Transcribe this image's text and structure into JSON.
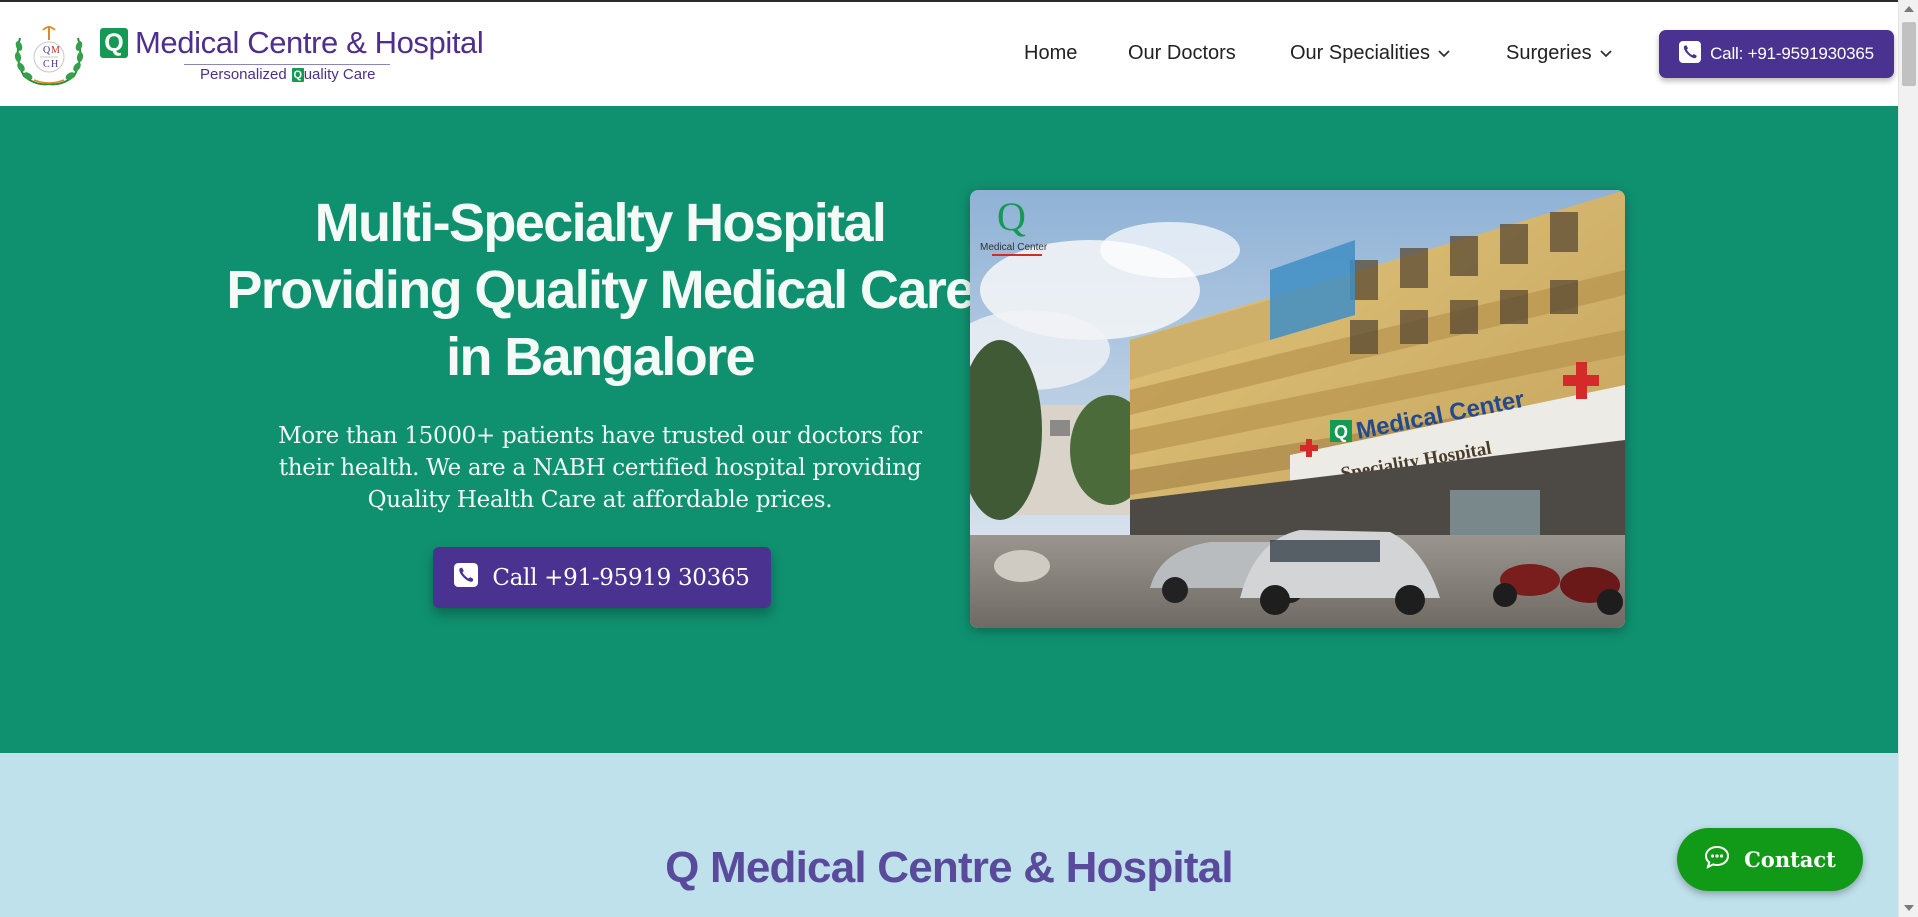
{
  "header": {
    "emblem_letters": [
      "Q",
      "M",
      "C",
      "H"
    ],
    "brand_q": "Q",
    "brand_name": "Medical Centre & Hospital",
    "tagline_pre": "Personalized",
    "tagline_q": "Q",
    "tagline_post": "uality Care",
    "nav": [
      {
        "label": "Home"
      },
      {
        "label": "Our Doctors"
      },
      {
        "label": "Our Specialities",
        "has_dropdown": true
      },
      {
        "label": "Surgeries",
        "has_dropdown": true
      }
    ],
    "call_button": "Call: +91-9591930365"
  },
  "hero": {
    "title": "Multi-Specialty Hospital Providing Quality Medical Care in Bangalore",
    "subtitle": "More than 15000+ patients have trusted our doctors for their health. We are a NABH certified hospital providing Quality Health Care at affordable prices.",
    "call_button": "Call +91-95919 30365",
    "photo": {
      "logo_q": "Q",
      "logo_text": "Medical Center",
      "sign_main": "Medical Center",
      "sign_sub": "Speciality Hospital"
    }
  },
  "about": {
    "title": "Q Medical Centre & Hospital"
  },
  "contact_button": "Contact",
  "colors": {
    "brand_purple": "#4a3290",
    "brand_green": "#159a54",
    "hero_bg": "#0f9170",
    "about_bg": "#bfe1ec",
    "contact_green": "#109a17"
  },
  "icons": [
    "qmch-emblem-icon",
    "phone-icon",
    "chevron-down-icon",
    "chat-bubble-icon"
  ]
}
